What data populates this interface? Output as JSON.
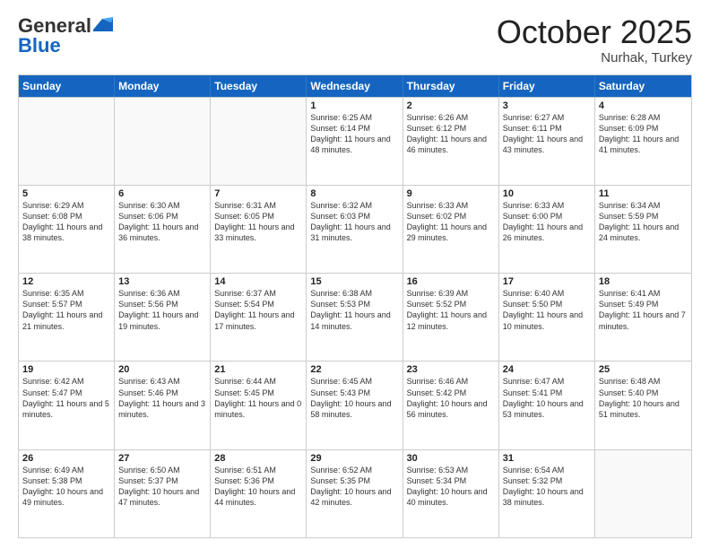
{
  "header": {
    "logo_general": "General",
    "logo_blue": "Blue",
    "month": "October 2025",
    "location": "Nurhak, Turkey"
  },
  "days_of_week": [
    "Sunday",
    "Monday",
    "Tuesday",
    "Wednesday",
    "Thursday",
    "Friday",
    "Saturday"
  ],
  "rows": [
    [
      {
        "day": "",
        "empty": true
      },
      {
        "day": "",
        "empty": true
      },
      {
        "day": "",
        "empty": true
      },
      {
        "day": "1",
        "sunrise": "Sunrise: 6:25 AM",
        "sunset": "Sunset: 6:14 PM",
        "daylight": "Daylight: 11 hours and 48 minutes."
      },
      {
        "day": "2",
        "sunrise": "Sunrise: 6:26 AM",
        "sunset": "Sunset: 6:12 PM",
        "daylight": "Daylight: 11 hours and 46 minutes."
      },
      {
        "day": "3",
        "sunrise": "Sunrise: 6:27 AM",
        "sunset": "Sunset: 6:11 PM",
        "daylight": "Daylight: 11 hours and 43 minutes."
      },
      {
        "day": "4",
        "sunrise": "Sunrise: 6:28 AM",
        "sunset": "Sunset: 6:09 PM",
        "daylight": "Daylight: 11 hours and 41 minutes."
      }
    ],
    [
      {
        "day": "5",
        "sunrise": "Sunrise: 6:29 AM",
        "sunset": "Sunset: 6:08 PM",
        "daylight": "Daylight: 11 hours and 38 minutes."
      },
      {
        "day": "6",
        "sunrise": "Sunrise: 6:30 AM",
        "sunset": "Sunset: 6:06 PM",
        "daylight": "Daylight: 11 hours and 36 minutes."
      },
      {
        "day": "7",
        "sunrise": "Sunrise: 6:31 AM",
        "sunset": "Sunset: 6:05 PM",
        "daylight": "Daylight: 11 hours and 33 minutes."
      },
      {
        "day": "8",
        "sunrise": "Sunrise: 6:32 AM",
        "sunset": "Sunset: 6:03 PM",
        "daylight": "Daylight: 11 hours and 31 minutes."
      },
      {
        "day": "9",
        "sunrise": "Sunrise: 6:33 AM",
        "sunset": "Sunset: 6:02 PM",
        "daylight": "Daylight: 11 hours and 29 minutes."
      },
      {
        "day": "10",
        "sunrise": "Sunrise: 6:33 AM",
        "sunset": "Sunset: 6:00 PM",
        "daylight": "Daylight: 11 hours and 26 minutes."
      },
      {
        "day": "11",
        "sunrise": "Sunrise: 6:34 AM",
        "sunset": "Sunset: 5:59 PM",
        "daylight": "Daylight: 11 hours and 24 minutes."
      }
    ],
    [
      {
        "day": "12",
        "sunrise": "Sunrise: 6:35 AM",
        "sunset": "Sunset: 5:57 PM",
        "daylight": "Daylight: 11 hours and 21 minutes."
      },
      {
        "day": "13",
        "sunrise": "Sunrise: 6:36 AM",
        "sunset": "Sunset: 5:56 PM",
        "daylight": "Daylight: 11 hours and 19 minutes."
      },
      {
        "day": "14",
        "sunrise": "Sunrise: 6:37 AM",
        "sunset": "Sunset: 5:54 PM",
        "daylight": "Daylight: 11 hours and 17 minutes."
      },
      {
        "day": "15",
        "sunrise": "Sunrise: 6:38 AM",
        "sunset": "Sunset: 5:53 PM",
        "daylight": "Daylight: 11 hours and 14 minutes."
      },
      {
        "day": "16",
        "sunrise": "Sunrise: 6:39 AM",
        "sunset": "Sunset: 5:52 PM",
        "daylight": "Daylight: 11 hours and 12 minutes."
      },
      {
        "day": "17",
        "sunrise": "Sunrise: 6:40 AM",
        "sunset": "Sunset: 5:50 PM",
        "daylight": "Daylight: 11 hours and 10 minutes."
      },
      {
        "day": "18",
        "sunrise": "Sunrise: 6:41 AM",
        "sunset": "Sunset: 5:49 PM",
        "daylight": "Daylight: 11 hours and 7 minutes."
      }
    ],
    [
      {
        "day": "19",
        "sunrise": "Sunrise: 6:42 AM",
        "sunset": "Sunset: 5:47 PM",
        "daylight": "Daylight: 11 hours and 5 minutes."
      },
      {
        "day": "20",
        "sunrise": "Sunrise: 6:43 AM",
        "sunset": "Sunset: 5:46 PM",
        "daylight": "Daylight: 11 hours and 3 minutes."
      },
      {
        "day": "21",
        "sunrise": "Sunrise: 6:44 AM",
        "sunset": "Sunset: 5:45 PM",
        "daylight": "Daylight: 11 hours and 0 minutes."
      },
      {
        "day": "22",
        "sunrise": "Sunrise: 6:45 AM",
        "sunset": "Sunset: 5:43 PM",
        "daylight": "Daylight: 10 hours and 58 minutes."
      },
      {
        "day": "23",
        "sunrise": "Sunrise: 6:46 AM",
        "sunset": "Sunset: 5:42 PM",
        "daylight": "Daylight: 10 hours and 56 minutes."
      },
      {
        "day": "24",
        "sunrise": "Sunrise: 6:47 AM",
        "sunset": "Sunset: 5:41 PM",
        "daylight": "Daylight: 10 hours and 53 minutes."
      },
      {
        "day": "25",
        "sunrise": "Sunrise: 6:48 AM",
        "sunset": "Sunset: 5:40 PM",
        "daylight": "Daylight: 10 hours and 51 minutes."
      }
    ],
    [
      {
        "day": "26",
        "sunrise": "Sunrise: 6:49 AM",
        "sunset": "Sunset: 5:38 PM",
        "daylight": "Daylight: 10 hours and 49 minutes."
      },
      {
        "day": "27",
        "sunrise": "Sunrise: 6:50 AM",
        "sunset": "Sunset: 5:37 PM",
        "daylight": "Daylight: 10 hours and 47 minutes."
      },
      {
        "day": "28",
        "sunrise": "Sunrise: 6:51 AM",
        "sunset": "Sunset: 5:36 PM",
        "daylight": "Daylight: 10 hours and 44 minutes."
      },
      {
        "day": "29",
        "sunrise": "Sunrise: 6:52 AM",
        "sunset": "Sunset: 5:35 PM",
        "daylight": "Daylight: 10 hours and 42 minutes."
      },
      {
        "day": "30",
        "sunrise": "Sunrise: 6:53 AM",
        "sunset": "Sunset: 5:34 PM",
        "daylight": "Daylight: 10 hours and 40 minutes."
      },
      {
        "day": "31",
        "sunrise": "Sunrise: 6:54 AM",
        "sunset": "Sunset: 5:32 PM",
        "daylight": "Daylight: 10 hours and 38 minutes."
      },
      {
        "day": "",
        "empty": true
      }
    ]
  ]
}
